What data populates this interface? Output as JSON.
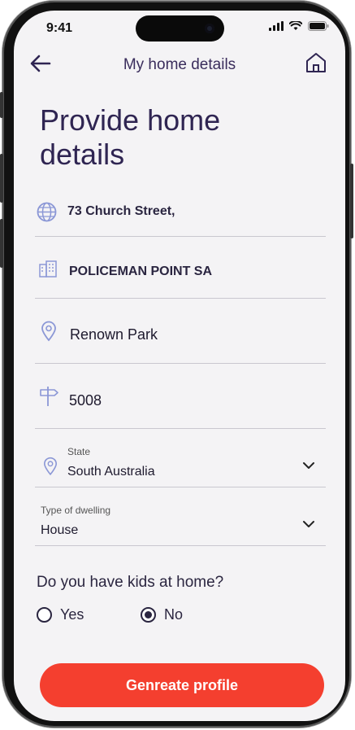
{
  "status": {
    "time": "9:41"
  },
  "nav": {
    "title": "My home details"
  },
  "page": {
    "title_line1": "Provide home",
    "title_line2": "details"
  },
  "fields": {
    "street": "73 Church Street,",
    "suburb_line": "POLICEMAN POINT SA",
    "area": "Renown Park",
    "postcode": "5008",
    "state": {
      "label": "State",
      "value": "South Australia"
    },
    "dwelling": {
      "label": "Type of dwelling",
      "value": "House"
    }
  },
  "kids": {
    "question": "Do you have kids at home?",
    "options": [
      {
        "label": "Yes",
        "selected": false
      },
      {
        "label": "No",
        "selected": true
      }
    ]
  },
  "cta": {
    "label": "Genreate profile"
  },
  "colors": {
    "accent": "#f43f2f",
    "title": "#2f2552",
    "icon": "#8b97d6"
  },
  "icons": [
    "back-arrow-icon",
    "home-icon",
    "globe-icon",
    "building-icon",
    "location-pin-icon",
    "signpost-icon",
    "chevron-down-icon"
  ]
}
